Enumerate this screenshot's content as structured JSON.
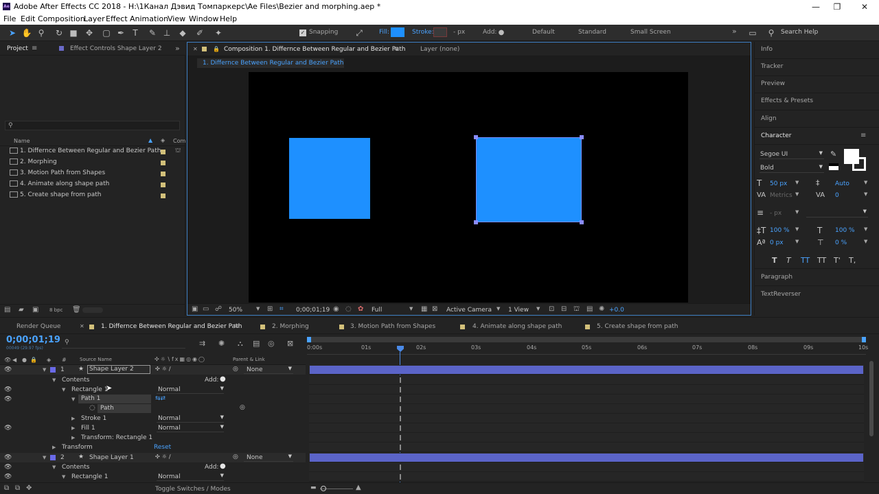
{
  "window": {
    "title": "Adobe After Effects CC 2018 - H:\\1Канал Дэвид Томпаркерс\\Ae Files\\Bezier and morphing.aep *",
    "app_badge": "Ae",
    "minimize": "—",
    "maximize": "❐",
    "close": "✕"
  },
  "menu": [
    "File",
    "Edit",
    "Composition",
    "Layer",
    "Effect",
    "Animation",
    "View",
    "Window",
    "Help"
  ],
  "toolbar": {
    "snapping_label": "Snapping",
    "fill_label": "Fill:",
    "fill_color": "#1e90ff",
    "stroke_label": "Stroke:",
    "stroke_px": "- px",
    "add_label": "Add:",
    "workspaces": [
      "Default",
      "Standard",
      "Small Screen"
    ],
    "overflow": "»",
    "search_placeholder": "Search Help"
  },
  "project_panel": {
    "tab_project": "Project",
    "tab_effect_controls": "Effect Controls Shape Layer 2",
    "search_icon_glyph": "⚲",
    "col_name": "Name",
    "col_comment": "Com",
    "items": [
      "1. Differnce Between Regular and Bezier Path",
      "2. Morphing",
      "3. Motion Path from Shapes",
      "4. Animate along shape path",
      "5. Create shape from path"
    ],
    "bpc": "8 bpc"
  },
  "composition_panel": {
    "tab_label": "Composition 1. Differnce Between Regular and Bezier Path",
    "layer_tab": "Layer (none)",
    "breadcrumb": "1. Differnce Between Regular and Bezier Path",
    "accent": "#1e90ff",
    "footer": {
      "zoom": "50%",
      "timecode": "0;00;01;19",
      "resolution": "Full",
      "camera": "Active Camera",
      "views": "1 View",
      "exposure": "+0.0"
    }
  },
  "right_panels": {
    "items": [
      "Info",
      "Tracker",
      "Preview",
      "Effects & Presets",
      "Align"
    ],
    "character": {
      "title": "Character",
      "font": "Segoe UI",
      "style": "Bold",
      "size": "50 px",
      "leading": "Auto",
      "kerning": "Metrics",
      "tracking": "0",
      "stroke_width": "- px",
      "vscale": "100 %",
      "hscale": "100 %",
      "baseline": "0 px",
      "tsume": "0 %",
      "style_buttons": [
        "T",
        "T",
        "TT",
        "TT",
        "T'",
        "T,"
      ]
    },
    "bottom_items": [
      "Paragraph",
      "TextReverser"
    ]
  },
  "timeline": {
    "tabs": [
      "Render Queue",
      "1. Differnce Between Regular and Bezier Path",
      "2. Morphing",
      "3. Motion Path from Shapes",
      "4. Animate along shape path",
      "5. Create shape from path"
    ],
    "timecode": "0;00;01;19",
    "frame_info": "00049 (29.97 fps)",
    "col_source_name": "Source Name",
    "col_parent": "Parent & Link",
    "ruler": [
      "0:00s",
      "01s",
      "02s",
      "03s",
      "04s",
      "05s",
      "06s",
      "07s",
      "08s",
      "09s",
      "10s"
    ],
    "layers": {
      "l1_num": "1",
      "l1_name": "Shape Layer 2",
      "l1_parent": "None",
      "contents": "Contents",
      "add": "Add:",
      "rect1": "Rectangle 1",
      "rect1_mode": "Normal",
      "path1": "Path 1",
      "path": "Path",
      "stroke1": "Stroke 1",
      "stroke1_mode": "Normal",
      "fill1": "Fill 1",
      "fill1_mode": "Normal",
      "transform_rect": "Transform: Rectangle 1",
      "transform": "Transform",
      "reset": "Reset",
      "l2_num": "2",
      "l2_name": "Shape Layer 1",
      "l2_parent": "None",
      "contents2": "Contents",
      "add2": "Add:",
      "rect1b": "Rectangle 1",
      "rect1b_mode": "Normal"
    },
    "toggle_switches": "Toggle Switches / Modes",
    "layer_bar_color": "#5b64c8"
  }
}
